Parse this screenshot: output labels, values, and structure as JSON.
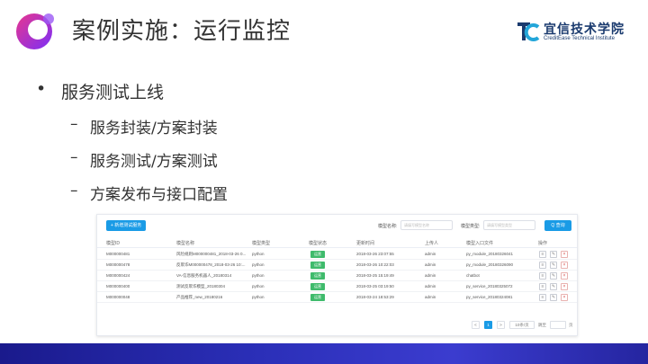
{
  "slide": {
    "title": "案例实施：运行监控",
    "brand_cn": "宜信技术学院",
    "brand_en": "CreditEase Technical Institute",
    "bullet_main": "服务测试上线",
    "bullet_symbol": "•",
    "dash_symbol": "–",
    "sub_bullets": [
      "服务封装/方案封装",
      "服务测试/方案测试",
      "方案发布与接口配置"
    ],
    "colors": {
      "accent": "#1a9be6",
      "status_green": "#3fbb6c",
      "band": "#2b2fb8",
      "logo_purple": "#7b2ff7",
      "logo_pink": "#e8368f"
    }
  },
  "app": {
    "new_button": "+ 新增测试服务",
    "filter_name_label": "模型名称:",
    "filter_name_placeholder": "请填写模型名称",
    "filter_type_label": "模型类型:",
    "filter_type_placeholder": "请填写模型类型",
    "query_button": "Q 查询",
    "columns": [
      "模型ID",
      "模型名称",
      "模型类型",
      "模型状态",
      "更新时间",
      "上传人",
      "模型入口文件",
      "操作"
    ],
    "rows": [
      {
        "id": "M000000481",
        "name": "风险规则M000000481_2018-03-26 0...",
        "type": "python",
        "status": "运营",
        "time": "2018-03-26 23:07:55",
        "user": "admin",
        "entry": "py_module_20180326041"
      },
      {
        "id": "M000000478",
        "name": "反欺诈M000000478_2018-03-26 10:...",
        "type": "python",
        "status": "运营",
        "time": "2018-03-26 10:22:03",
        "user": "admin",
        "entry": "py_module_20180326090"
      },
      {
        "id": "M000000424",
        "name": "VA-信息服务机器人_20180314",
        "type": "python",
        "status": "运营",
        "time": "2018-03-25 15:19:49",
        "user": "admin",
        "entry": "chatbot"
      },
      {
        "id": "M000000400",
        "name": "测试反欺诈模型_20180304",
        "type": "python",
        "status": "运营",
        "time": "2018-03-25 03:19:50",
        "user": "admin",
        "entry": "py_service_20180325072"
      },
      {
        "id": "M000000048",
        "name": "产品推荐_new_20180216",
        "type": "python",
        "status": "运营",
        "time": "2018-03-24 18:53:29",
        "user": "admin",
        "entry": "py_service_20180324081"
      }
    ],
    "op_icons": [
      "view-icon",
      "edit-icon",
      "delete-icon"
    ],
    "pagination": {
      "prev": "<",
      "page": "1",
      "next": ">",
      "page_size": "10条/页",
      "goto_label": "跳至",
      "goto_suffix": "页"
    }
  }
}
